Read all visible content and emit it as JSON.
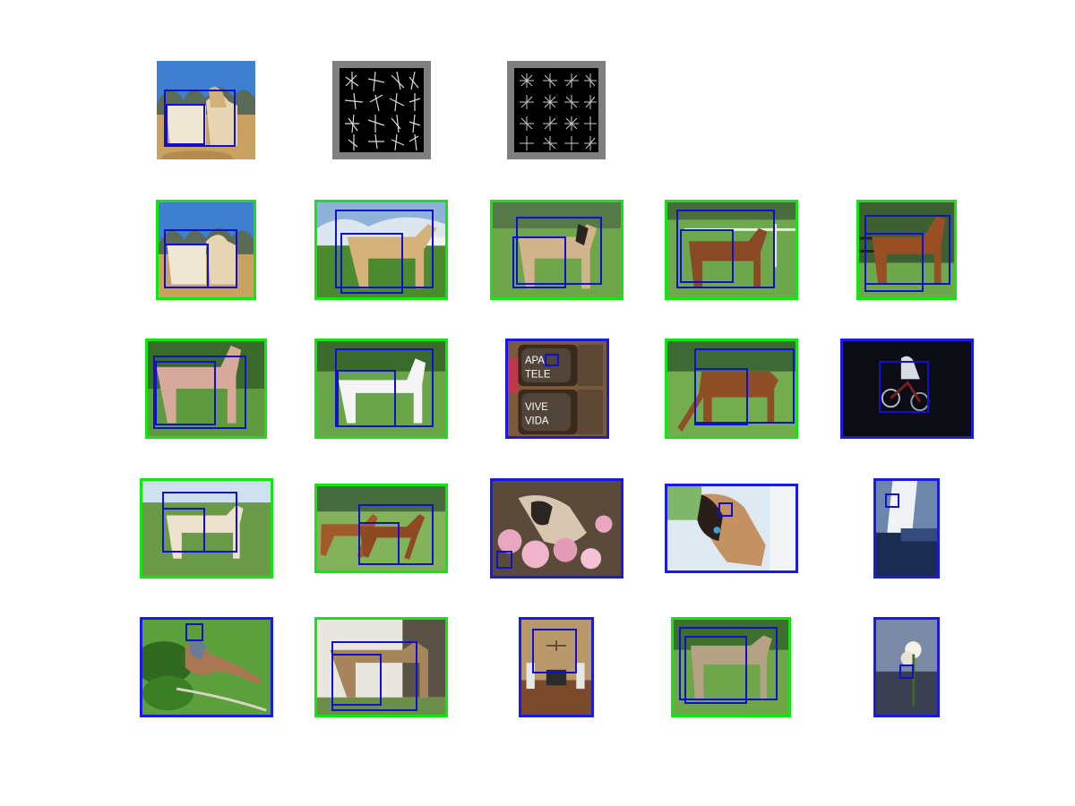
{
  "figure": {
    "rows": [
      {
        "row": "query",
        "items": [
          {
            "kind": "photo",
            "scene": "horses-sky-trees"
          },
          {
            "kind": "feature-visualization",
            "name": "hog-positive"
          },
          {
            "kind": "feature-visualization",
            "name": "hog-negative"
          }
        ]
      },
      {
        "row": "detections-1",
        "items": [
          {
            "frame": "green",
            "scene": "horses-sky-trees"
          },
          {
            "frame": "green",
            "scene": "palomino-field"
          },
          {
            "frame": "green",
            "scene": "buckskin-horse-field"
          },
          {
            "frame": "green",
            "scene": "brown-horse-fence"
          },
          {
            "frame": "green",
            "scene": "brown-horse-trees"
          }
        ]
      },
      {
        "row": "detections-2",
        "items": [
          {
            "frame": "green",
            "scene": "pinkish-horse-trees"
          },
          {
            "frame": "green",
            "scene": "white-horse-field"
          },
          {
            "frame": "blue",
            "scene": "old-televisions"
          },
          {
            "frame": "green",
            "scene": "grazing-horse"
          },
          {
            "frame": "blue",
            "scene": "cyclist-night"
          }
        ]
      },
      {
        "row": "detections-3",
        "items": [
          {
            "frame": "green",
            "scene": "cream-horse-pasture"
          },
          {
            "frame": "green",
            "scene": "running-horses"
          },
          {
            "frame": "blue",
            "scene": "cat-flowers"
          },
          {
            "frame": "blue",
            "scene": "siamese-cat"
          },
          {
            "frame": "blue",
            "scene": "sailboat"
          }
        ]
      },
      {
        "row": "detections-4",
        "items": [
          {
            "frame": "blue",
            "scene": "bird-leaves"
          },
          {
            "frame": "green",
            "scene": "horse-stable"
          },
          {
            "frame": "blue",
            "scene": "room-interior"
          },
          {
            "frame": "green",
            "scene": "pony-grass"
          },
          {
            "frame": "blue",
            "scene": "flower-window"
          }
        ]
      }
    ],
    "colors": {
      "true_positive_frame": "#11e611",
      "false_positive_frame": "#1a1ae6",
      "detection_box": "#1010d0",
      "feature_background": "#7f7f7f"
    }
  }
}
